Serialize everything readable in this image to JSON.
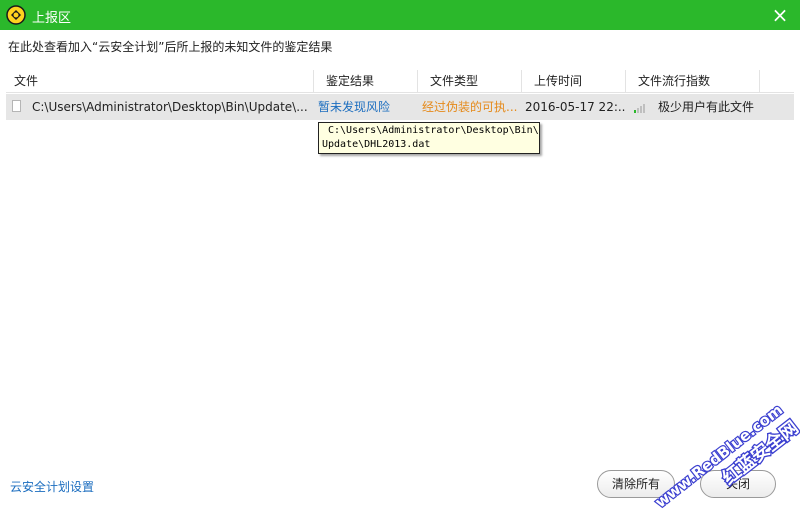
{
  "window": {
    "title": "上报区",
    "close_glyph": "×"
  },
  "description": "在此处查看加入“云安全计划”后所上报的未知文件的鉴定结果",
  "table": {
    "columns": [
      "文件",
      "鉴定结果",
      "文件类型",
      "上传时间",
      "文件流行指数"
    ],
    "rows": [
      {
        "file": "C:\\Users\\Administrator\\Desktop\\Bin\\Update\\...",
        "result": "暂未发现风险",
        "type": "经过伪装的可执...",
        "time": "2016-05-17 22:...",
        "popularity_level": 0.25,
        "popularity": "极少用户有此文件"
      }
    ]
  },
  "tooltip": {
    "line1": "C:\\Users\\Administrator\\Desktop\\Bin\\",
    "line2": "Update\\DHL2013.dat"
  },
  "footer": {
    "settings_link": "云安全计划设置",
    "clear_all": "清除所有",
    "close_btn": "关闭"
  },
  "watermark": {
    "text1": "www.RedBlue.com",
    "text2": "红蓝安全网"
  },
  "colors": {
    "titlebar": "#2bb82b",
    "link": "#1b6dbf",
    "warning": "#e58a1a",
    "row_selected": "#e6e6e6"
  }
}
